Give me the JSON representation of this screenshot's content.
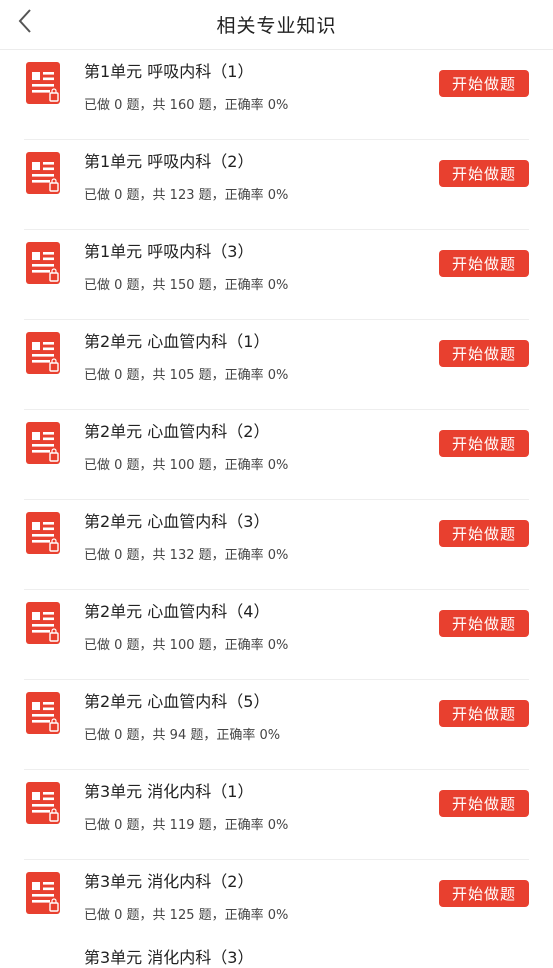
{
  "header": {
    "title": "相关专业知识",
    "back_icon": "chevron-left-icon"
  },
  "colors": {
    "accent": "#e8402f"
  },
  "list": {
    "button_label": "开始做题",
    "items": [
      {
        "name": "第1单元 呼吸内科（1）",
        "meta": "已做 0 题，共 160 题，正确率 0%"
      },
      {
        "name": "第1单元 呼吸内科（2）",
        "meta": "已做 0 题，共 123 题，正确率 0%"
      },
      {
        "name": "第1单元 呼吸内科（3）",
        "meta": "已做 0 题，共 150 题，正确率 0%"
      },
      {
        "name": "第2单元 心血管内科（1）",
        "meta": "已做 0 题，共 105 题，正确率 0%"
      },
      {
        "name": "第2单元 心血管内科（2）",
        "meta": "已做 0 题，共 100 题，正确率 0%"
      },
      {
        "name": "第2单元 心血管内科（3）",
        "meta": "已做 0 题，共 132 题，正确率 0%"
      },
      {
        "name": "第2单元 心血管内科（4）",
        "meta": "已做 0 题，共 100 题，正确率 0%"
      },
      {
        "name": "第2单元 心血管内科（5）",
        "meta": "已做 0 题，共 94 题，正确率 0%"
      },
      {
        "name": "第3单元 消化内科（1）",
        "meta": "已做 0 题，共 119 题，正确率 0%"
      },
      {
        "name": "第3单元 消化内科（2）",
        "meta": "已做 0 题，共 125 题，正确率 0%"
      }
    ],
    "partial_item": "第3单元 消化内科（3）"
  }
}
